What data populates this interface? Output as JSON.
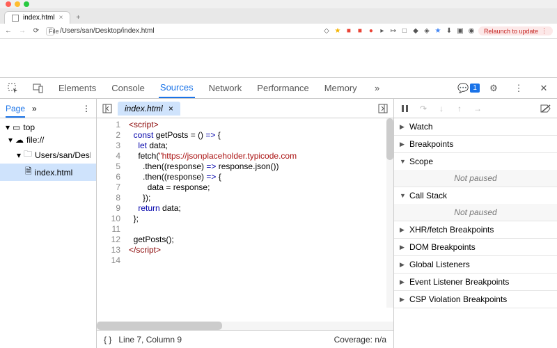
{
  "browser": {
    "tab_title": "index.html",
    "url_prefix": "File",
    "url": "/Users/san/Desktop/index.html",
    "relaunch": "Relaunch to update"
  },
  "devtools": {
    "tabs": [
      "Elements",
      "Console",
      "Sources",
      "Network",
      "Performance",
      "Memory"
    ],
    "active_tab": "Sources",
    "message_count": "1"
  },
  "left": {
    "page_tab": "Page",
    "tree": {
      "top": "top",
      "origin": "file://",
      "folder": "Users/san/Desktop",
      "file": "index.html"
    }
  },
  "editor": {
    "filename": "index.html",
    "line_count": 14,
    "lines": [
      "<script>",
      "  const getPosts = () => {",
      "    let data;",
      "    fetch(\"https://jsonplaceholder.typicode.com",
      "      .then((response) => response.json())",
      "      .then((response) => {",
      "        data = response;",
      "      });",
      "    return data;",
      "  };",
      "",
      "  getPosts();",
      "</script>",
      ""
    ],
    "status_pos": "Line 7, Column 9",
    "coverage": "Coverage: n/a"
  },
  "right": {
    "sections": {
      "watch": "Watch",
      "breakpoints": "Breakpoints",
      "scope": "Scope",
      "callstack": "Call Stack",
      "xhr": "XHR/fetch Breakpoints",
      "dom": "DOM Breakpoints",
      "global": "Global Listeners",
      "event": "Event Listener Breakpoints",
      "csp": "CSP Violation Breakpoints"
    },
    "not_paused": "Not paused"
  }
}
